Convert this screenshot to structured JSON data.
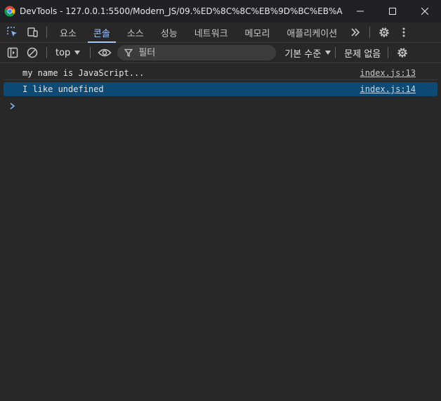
{
  "window": {
    "title": "DevTools - 127.0.0.1:5500/Modern_JS/09.%ED%8C%8C%EB%9D%BC%EB%AF%B8%..."
  },
  "tabs": [
    {
      "label": "요소"
    },
    {
      "label": "콘솔",
      "active": true
    },
    {
      "label": "소스"
    },
    {
      "label": "성능"
    },
    {
      "label": "네트워크"
    },
    {
      "label": "메모리"
    },
    {
      "label": "애플리케이션"
    }
  ],
  "toolbar": {
    "context": "top",
    "filter_placeholder": "필터",
    "levels": "기본 수준",
    "issues": "문제 없음"
  },
  "console": {
    "messages": [
      {
        "text": "my name is JavaScript...",
        "source": "index.js:13"
      },
      {
        "text": "I like undefined",
        "source": "index.js:14",
        "selected": true
      }
    ]
  },
  "colors": {
    "background": "#282828",
    "accent": "#a8c7fa",
    "selected_row": "#0e4a73"
  }
}
